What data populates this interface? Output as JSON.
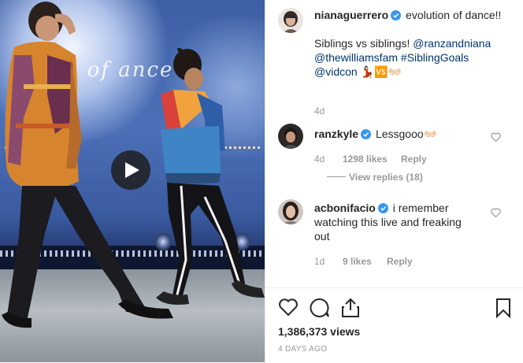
{
  "video": {
    "stage_text": "on of  ance",
    "play_label": "Play"
  },
  "caption": {
    "username": "nianaguerrero",
    "text_intro": "evolution of dance!!",
    "text_siblings": "Siblings vs siblings!",
    "mention_ranzandniana": "@ranzandniana",
    "mention_williamsfam": "@thewilliamsfam",
    "hashtag": "#SiblingGoals",
    "mention_vidcon": "@vidcon",
    "emojis": "💃🏻🆚👐🏻",
    "time": "4d"
  },
  "comments": [
    {
      "username": "ranzkyle",
      "text": "Lessgooo👐🏻",
      "time": "4d",
      "likes": "1298 likes",
      "reply": "Reply",
      "view_replies": "View replies (18)"
    },
    {
      "username": "acbonifacio",
      "text": "i remember watching this live and freaking out",
      "time": "1d",
      "likes": "9 likes",
      "reply": "Reply"
    }
  ],
  "stats": {
    "views": "1,386,373 views",
    "date": "4 DAYS AGO"
  },
  "colors": {
    "verified": "#3897f0",
    "link": "#003569",
    "muted": "#999999"
  },
  "icons": [
    "play-icon",
    "verified-icon",
    "heart-icon",
    "comment-icon",
    "share-icon",
    "bookmark-icon"
  ]
}
